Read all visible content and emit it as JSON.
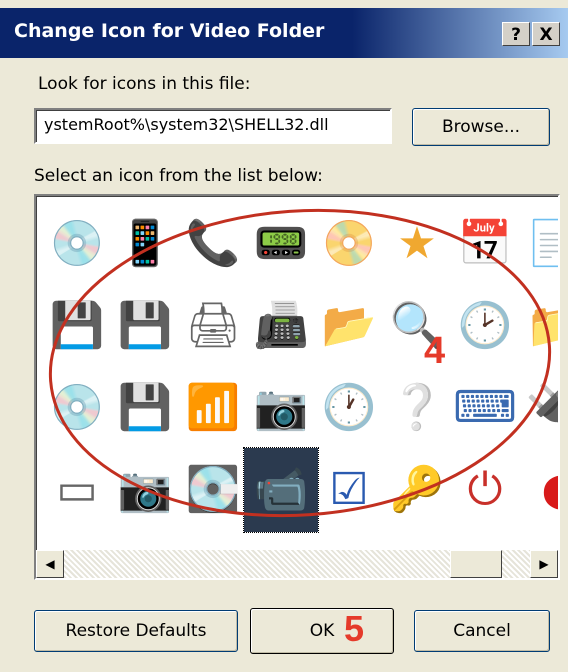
{
  "window": {
    "title": "Change Icon for Video Folder",
    "help_button": "?",
    "close_button": "X"
  },
  "file_label": "Look for icons in this file:",
  "file_path": "ystemRoot%\\system32\\SHELL32.dll",
  "browse_label": "Browse...",
  "list_label": "Select an icon from the list below:",
  "icons": [
    [
      {
        "name": "cd-disc-icon",
        "glyph": "💿",
        "color": "#8a8ac8"
      },
      {
        "name": "phone-card-icon",
        "glyph": "📱",
        "color": "#555"
      },
      {
        "name": "cellphone-icon",
        "glyph": "📞",
        "color": "#666"
      },
      {
        "name": "pda-icon",
        "glyph": "📟",
        "color": "#c8903a"
      },
      {
        "name": "dvd-rw-disc-icon",
        "glyph": "📀",
        "color": "#555"
      },
      {
        "name": "star-icon",
        "glyph": "★",
        "color": "#f0a830"
      },
      {
        "name": "calendar-folder-icon",
        "glyph": "📅",
        "color": "#3a6ab0"
      },
      {
        "name": "partial-icon",
        "glyph": "📄",
        "color": "#3a6ab0"
      }
    ],
    [
      {
        "name": "floppy-disk-red-icon",
        "glyph": "💾",
        "color": "#c8302a"
      },
      {
        "name": "memory-card-icon",
        "glyph": "💾",
        "color": "#203a8a"
      },
      {
        "name": "network-printer-icon",
        "glyph": "🖨",
        "color": "#666"
      },
      {
        "name": "scanner-icon",
        "glyph": "📠",
        "color": "#777"
      },
      {
        "name": "open-folder-icon",
        "glyph": "📂",
        "color": "#e0b030"
      },
      {
        "name": "magnifier-icon",
        "glyph": "🔍",
        "color": "#3a7ac8"
      },
      {
        "name": "scheduled-document-icon",
        "glyph": "🕑",
        "color": "#3a6ab0"
      },
      {
        "name": "partial-icon",
        "glyph": "📁",
        "color": "#c8903a"
      }
    ],
    [
      {
        "name": "dvd-rom-disc-icon",
        "glyph": "💿",
        "color": "#555"
      },
      {
        "name": "floppy-disk-yellow-icon",
        "glyph": "💾",
        "color": "#203a8a"
      },
      {
        "name": "modem-icon",
        "glyph": "📶",
        "color": "#2a6a3a"
      },
      {
        "name": "digital-camera-icon",
        "glyph": "📷",
        "color": "#666"
      },
      {
        "name": "clock-icon",
        "glyph": "🕐",
        "color": "#3aa040"
      },
      {
        "name": "help-icon",
        "glyph": "❔",
        "color": "#1a4ac8"
      },
      {
        "name": "drive-icon",
        "glyph": "⌨",
        "color": "#3a6ab0"
      },
      {
        "name": "partial-icon",
        "glyph": "🔌",
        "color": "#555"
      }
    ],
    [
      {
        "name": "hard-drive-icon",
        "glyph": "▭",
        "color": "#666"
      },
      {
        "name": "camera-icon",
        "glyph": "📷",
        "color": "#555"
      },
      {
        "name": "zip-drive-icon",
        "glyph": "💽",
        "color": "#3a5ab0"
      },
      {
        "name": "video-camera-icon",
        "glyph": "📹",
        "color": "#aab"
      },
      {
        "name": "checklist-icon",
        "glyph": "☑",
        "color": "#2a5ab0"
      },
      {
        "name": "key-icon",
        "glyph": "🔑",
        "color": "#e0a030"
      },
      {
        "name": "power-icon",
        "glyph": "⏻",
        "color": "#c8302a"
      },
      {
        "name": "partial-icon",
        "glyph": "◖",
        "color": "#d81a1a"
      }
    ]
  ],
  "selected_icon": "video-camera-icon",
  "scrollbar": {
    "left_arrow": "◀",
    "right_arrow": "▶"
  },
  "buttons": {
    "restore": "Restore Defaults",
    "ok": "OK",
    "cancel": "Cancel"
  },
  "annotations": {
    "step4": "4",
    "step5": "5",
    "color": "#e53a2a"
  }
}
